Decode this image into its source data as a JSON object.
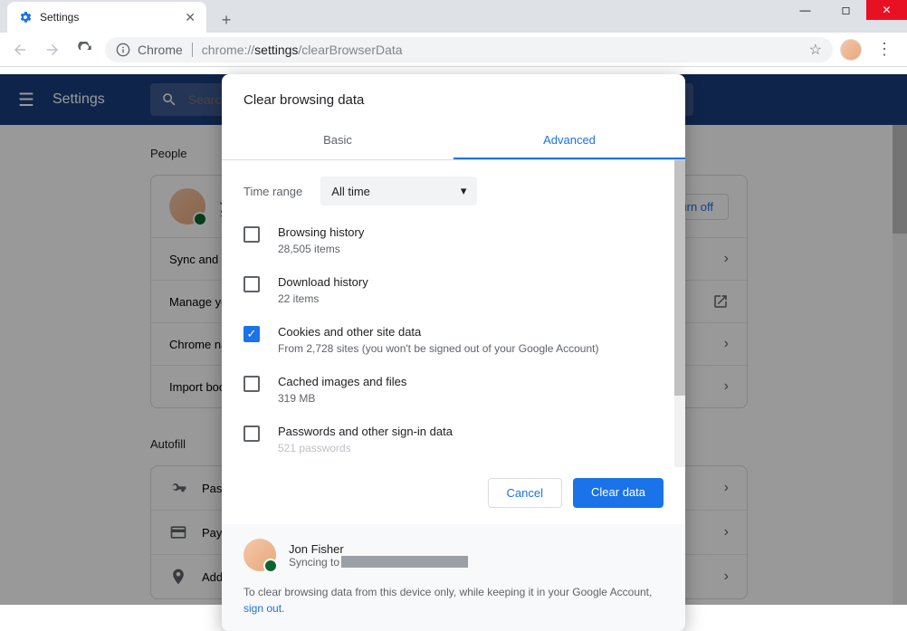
{
  "window": {
    "tab_title": "Settings",
    "addr_prefix": "Chrome",
    "addr_path_gray": "chrome://",
    "addr_path_bold": "settings",
    "addr_path_rest": "/clearBrowserData"
  },
  "settings": {
    "title": "Settings",
    "search_placeholder": "Search settings",
    "people_section": "People",
    "profile_name": "J",
    "profile_sub": "S",
    "turn_off": "Turn off",
    "rows": {
      "sync": "Sync and G",
      "manage": "Manage yo",
      "chrome_name": "Chrome na",
      "import": "Import boo"
    },
    "autofill_section": "Autofill",
    "autofill_rows": {
      "passwords": "Pass",
      "payments": "Pay",
      "addresses": "Add"
    }
  },
  "dialog": {
    "title": "Clear browsing data",
    "tab_basic": "Basic",
    "tab_advanced": "Advanced",
    "time_label": "Time range",
    "time_value": "All time",
    "items": [
      {
        "title": "Browsing history",
        "sub": "28,505 items",
        "checked": false
      },
      {
        "title": "Download history",
        "sub": "22 items",
        "checked": false
      },
      {
        "title": "Cookies and other site data",
        "sub": "From 2,728 sites (you won't be signed out of your Google Account)",
        "checked": true
      },
      {
        "title": "Cached images and files",
        "sub": "319 MB",
        "checked": false
      },
      {
        "title": "Passwords and other sign-in data",
        "sub": "521 passwords",
        "checked": false
      }
    ],
    "cancel": "Cancel",
    "clear": "Clear data",
    "user_name": "Jon Fisher",
    "syncing_to": "Syncing to",
    "footer_text": "To clear browsing data from this device only, while keeping it in your Google Account, ",
    "sign_out": "sign out"
  }
}
